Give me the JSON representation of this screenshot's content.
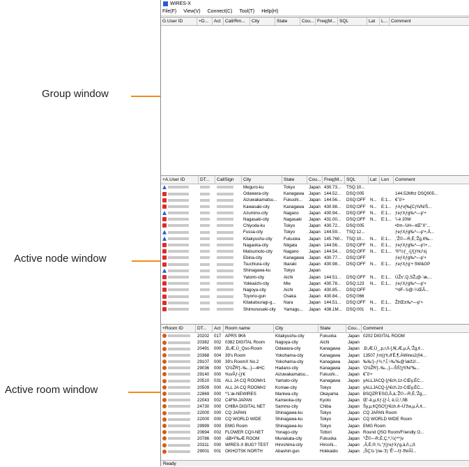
{
  "callouts": {
    "group": "Group window",
    "node": "Active node window",
    "room": "Active room window"
  },
  "app": {
    "title": "WIRES-X",
    "menu": [
      "File(F)",
      "View(V)",
      "Connect(C)",
      "Tool(T)",
      "Help(H)"
    ],
    "status": "Ready"
  },
  "group_window": {
    "headers": [
      "G.User ID",
      "+D...",
      "Act",
      "Call/Rm...",
      "City",
      "State",
      "Cou...",
      "Freq(M...",
      "SQL",
      "Lat",
      "L...",
      "Comment"
    ]
  },
  "node_window": {
    "headers": [
      "+A.User ID",
      "DT...",
      "CallSign",
      "City",
      "State",
      "Cou...",
      "Freq(M...",
      "SQL",
      "Lat",
      "Lon",
      "Comment"
    ],
    "rows": [
      {
        "icon": "a",
        "city": "Meguro-ku",
        "state": "Tokyo",
        "country": "Japan",
        "freq": "430.73...",
        "sql": "TSQ:10...",
        "lat": "",
        "lon": "",
        "comment": ""
      },
      {
        "icon": "d",
        "city": "Odawara-city",
        "state": "Kanagawa",
        "country": "Japan",
        "freq": "144.52...",
        "sql": "DSQ:005",
        "lat": "",
        "lon": "",
        "comment": "144.52Mhz DSQ005..."
      },
      {
        "icon": "d",
        "city": "Aizuwakamatsu...",
        "state": "Fukushi...",
        "country": "Japan",
        "freq": "144.56...",
        "sql": "DSQ:OFF",
        "lat": "N...",
        "lon": "E:1...",
        "comment": "€˜ô'+"
      },
      {
        "icon": "d",
        "city": "Kawasaki-city",
        "state": "Kanagawa",
        "country": "Japan",
        "freq": "430.98...",
        "sql": "DSQ:OFF",
        "lat": "N...",
        "lon": "E:1...",
        "comment": "ƒAƒv[‰[Cƒh/N/Š..."
      },
      {
        "icon": "a",
        "city": "Azumino-city",
        "state": "Nagano",
        "country": "Japan",
        "freq": "430.94...",
        "sql": "DSQ:OFF",
        "lat": "N...",
        "lon": "E:1...",
        "comment": "ƒeƒXƒg‰^—p'+"
      },
      {
        "icon": "d",
        "city": "Nagasaki-city",
        "state": "Nagasaki",
        "country": "Japan",
        "freq": "431.00...",
        "sql": "DSQ:OFF",
        "lat": "N...",
        "lon": "E:1...",
        "comment": "'í-è 20W"
      },
      {
        "icon": "d",
        "city": "Chiyoda-ku",
        "state": "Tokyo",
        "country": "Japan",
        "freq": "430.72...",
        "sql": "DSQ:005",
        "lat": "",
        "lon": "",
        "comment": "•žm–'üH—ŧŒ\"X\"..."
      },
      {
        "icon": "a",
        "city": "Fussa-city",
        "state": "Tokyo",
        "country": "Japan",
        "freq": "144.59...",
        "sql": "TSQ:12...",
        "lat": "",
        "lon": "",
        "comment": "ƒeƒXƒg‰^—p'+,Å..."
      },
      {
        "icon": "a",
        "city": "Kitakyushu-city",
        "state": "Fukuoka",
        "country": "Japan",
        "freq": "145.760...",
        "sql": "TSQ:10...",
        "lat": "N...",
        "lon": "E:1...",
        "comment": ",'Ž©—R,È,'Žg,¢‰..."
      },
      {
        "icon": "d",
        "city": "Nagaoka-city",
        "state": "Niigata",
        "country": "Japan",
        "freq": "144.56...",
        "sql": "DSQ:OFF",
        "lat": "N...",
        "lon": "E:1...",
        "comment": "ƒeƒXƒg‰^—p'í+..."
      },
      {
        "icon": "d",
        "city": "Matsumoto-city",
        "state": "Nagano",
        "country": "Japan",
        "freq": "144.54...",
        "sql": "DSQ:OFF",
        "lat": "N...",
        "lon": "E:1...",
        "comment": "'®'½ƒ_-[ƒ[ƒhU'±j"
      },
      {
        "icon": "d",
        "city": "Ebina-city",
        "state": "Kanagawa",
        "country": "Japan",
        "freq": "430.77...",
        "sql": "DSQ:OFF",
        "lat": "",
        "lon": "",
        "comment": "ƒeƒXƒg‰^—p'+"
      },
      {
        "icon": "d",
        "city": "Tsuchiura-city",
        "state": "Ibaraki",
        "country": "Japan",
        "freq": "430.98...",
        "sql": "DSQ:OFF",
        "lat": "N...",
        "lon": "E:1...",
        "comment": "ƒeƒXƒg'+ 5W&GP"
      },
      {
        "icon": "a",
        "city": "Shinagawa-ku",
        "state": "Tokyo",
        "country": "Japan",
        "freq": "",
        "sql": "",
        "lat": "",
        "lon": "",
        "comment": ""
      },
      {
        "icon": "d",
        "city": "Yatomi-city",
        "state": "Aichi",
        "country": "Japan",
        "freq": "144.51...",
        "sql": "DSQ:OFF",
        "lat": "N...",
        "lon": "E:1...",
        "comment": "ÚŽ±',Q,SŽ¡@-'æ,..."
      },
      {
        "icon": "d",
        "city": "Yokkaichi-city",
        "state": "Mie",
        "country": "Japan",
        "freq": "430.78...",
        "sql": "DSQ:123",
        "lat": "N...",
        "lon": "E:1...",
        "comment": "ƒeƒXƒg‰^—p'+"
      },
      {
        "icon": "d",
        "city": "Nagoya-city",
        "state": "Aichi",
        "country": "Japan",
        "freq": "430.85...",
        "sql": "DSQ:OFF",
        "lat": "",
        "lon": "",
        "comment": "'^dF–'ü@-¼ŒÃ..."
      },
      {
        "icon": "d",
        "city": "Toyono-gun",
        "state": "Osaka",
        "country": "Japan",
        "freq": "430.84...",
        "sql": "DSQ:066",
        "lat": "",
        "lon": "",
        "comment": ""
      },
      {
        "icon": "d",
        "city": "Kitakatsuragi-g...",
        "state": "Nara",
        "country": "Japan",
        "freq": "144.51...",
        "sql": "DSQ:OFF",
        "lat": "N...",
        "lon": "E:1...",
        "comment": "ŽžŒ±‰^—p'+"
      },
      {
        "icon": "d",
        "city": "Shimonoseki-city",
        "state": "Yamagu...",
        "country": "Japan",
        "freq": "438.1M...",
        "sql": "DSQ:001",
        "lat": "N...",
        "lon": "E:1...",
        "comment": ""
      }
    ]
  },
  "room_window": {
    "headers": [
      "+Room ID",
      "DT...",
      "Act",
      "Room name",
      "City",
      "State",
      "Cou...",
      "Comment"
    ],
    "rows": [
      {
        "id": "20202",
        "act": "017",
        "name": "APRS 9K6",
        "city": "Kitakyushu-city",
        "state": "Fukuoka",
        "country": "Japan",
        "comment": "0202 DIGITAL ROOM"
      },
      {
        "id": "20382",
        "act": "002",
        "name": "0382 DIGITAL Room",
        "city": "Nagoya-city",
        "state": "Aichi",
        "country": "Japan",
        "comment": ""
      },
      {
        "id": "20491",
        "act": "000",
        "name": "‚Ð,Æ,Ü_Qso-Room",
        "city": "Odawara-city",
        "state": "Kanagawa",
        "country": "Japan",
        "comment": ",Ð,Æ,Ü_,p,r,ñ-[,f€,Æ,µ,Ä,'Žg,¢..."
      },
      {
        "id": "20368",
        "act": "004",
        "name": "39's Room",
        "city": "Yokohama-city",
        "state": "Kanagawa",
        "country": "Japan",
        "comment": "13507 ƒm[ƒh,ð'É,¶,ÄWires2(04..."
      },
      {
        "id": "29107",
        "act": "000",
        "name": "39's RoomX No.2",
        "city": "Yokohama-city",
        "state": "Kanagawa",
        "country": "Japan",
        "comment": "‰‰'[–ƒ¾,ª,Î,'‹‰'‰@'iæž2/..."
      },
      {
        "id": "29036",
        "act": "000",
        "name": "'O'òŽR'[–‰...]—4HC",
        "city": "Hadano-city",
        "state": "Kanagawa",
        "country": "Japan",
        "comment": "'O'òŽR'[–‰...]—ŠŠ'[ƒf/N/'‰..."
      },
      {
        "id": "29140",
        "act": "000",
        "name": "%o/Âƒ-[ƒ€",
        "city": "Aizuwakamatsu...",
        "state": "Fukushi...",
        "country": "Japan",
        "comment": "€˜ô'+"
      },
      {
        "id": "20510",
        "act": "031",
        "name": "ALL JA CQ ROOM#1",
        "city": "Yamato-city",
        "state": "Kanagawa",
        "country": "Japan",
        "comment": "yALLJACQ-[ƒ€ch.1z-CŒy,ÉC..."
      },
      {
        "id": "20509",
        "act": "000",
        "name": "ALL JA CQ ROOM#2",
        "city": "Komae-city",
        "state": "Tokyo",
        "country": "Japan",
        "comment": "yALLJACQ-[ƒ€ch.2z-CŒy,ÉC..."
      },
      {
        "id": "22869",
        "act": "000",
        "name": "'ᵗ'L'æ-NEWIRES",
        "city": "Maniwa-city",
        "state": "Okayama",
        "country": "Japan",
        "comment": "BSQZR'ESO,Å,à,'Ž©—R,È,'Žg,..."
      },
      {
        "id": "22043",
        "act": "002",
        "name": "C4FM-JAPAN",
        "city": "Kameoka-city",
        "state": "Kyoto",
        "country": "Japan",
        "comment": "Œ'-ê,µ,¢ƒ-[ƒ-Ì, ë,Ü,¹,ñB"
      },
      {
        "id": "24730",
        "act": "000",
        "name": "CHIBA DIGITAL NET",
        "city": "Sammu-city",
        "state": "Chiba",
        "country": "Japan",
        "comment": "Šy,µ,¢QSO'[ƒ€ch.ð–Ú'žw,µ,Ä,¢..."
      },
      {
        "id": "22000",
        "act": "000",
        "name": "CQ JAPAN",
        "city": "Shinagawa-ku",
        "state": "Tokyo",
        "country": "Japan",
        "comment": "CQ JAPAN Room"
      },
      {
        "id": "22000",
        "act": "000",
        "name": "CQ WORLD WIDE",
        "city": "Shinagawa-ku",
        "state": "Tokyo",
        "country": "Japan",
        "comment": "CQ WORLD WIDE Room"
      },
      {
        "id": "29999",
        "act": "000",
        "name": "EMG Room",
        "city": "Shinagawa-ku",
        "state": "Tokyo",
        "country": "Japan",
        "comment": "EMG Room"
      },
      {
        "id": "20694",
        "act": "002",
        "name": "FLOWER CQ/I-NET",
        "city": "Yonago-city",
        "state": "Tottori",
        "country": "Japan",
        "comment": "Round QSO Room/Friendly O..."
      },
      {
        "id": "20786",
        "act": "000",
        "name": "‹ãB•Ý‰Æ ROOM",
        "city": "Munakata-city",
        "state": "Fukuoka",
        "country": "Japan",
        "comment": "'²Ž©—R,È,Ç,ª,¼(^^)v"
      },
      {
        "id": "20311",
        "act": "000",
        "name": "WIRES-X BUG? TEST",
        "city": "Hiroshima-city",
        "state": "Hiroshi...",
        "country": "Japan",
        "comment": ",Ã,É,®,¾,\"ƒ[ƒeƒXƒg,à,ñ,¡,ß"
      },
      {
        "id": "29001",
        "act": "001",
        "name": "OKHOTSK NORTH",
        "city": "Abashiri-gun",
        "state": "Hokkaido",
        "country": "Japan",
        "comment": "„ŠÇ'ü-'(ne-'ž) 'Ê'—fƒ-fN/ÃÌ..."
      }
    ]
  },
  "colors": {
    "accent": "#f08a1c",
    "node_a": "#1e5fd6",
    "node_d": "#e02a2a",
    "room": "#d85a12"
  },
  "icons": {
    "a": "analog-node-icon",
    "d": "digital-node-icon",
    "room": "room-icon"
  }
}
